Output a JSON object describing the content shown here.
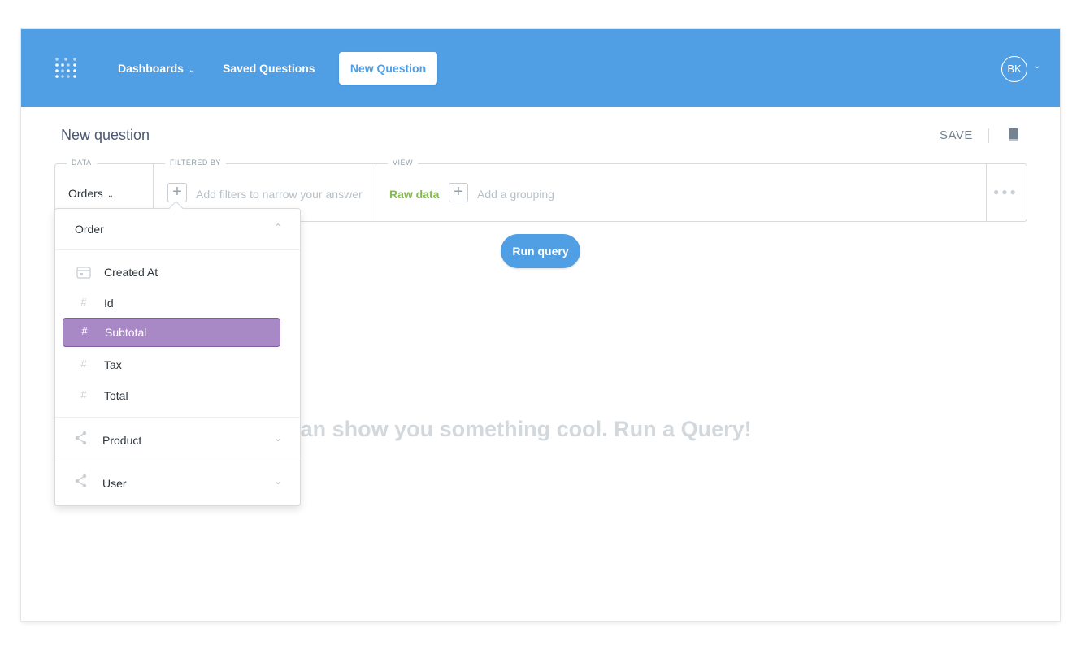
{
  "nav": {
    "logo_icon": "metabase-logo-icon",
    "dashboards": "Dashboards",
    "saved_questions": "Saved Questions",
    "new_question": "New Question",
    "avatar_initials": "BK"
  },
  "header": {
    "title": "New question",
    "save_label": "SAVE",
    "reference_icon": "book-icon"
  },
  "query": {
    "data_label": "DATA",
    "table": "Orders",
    "filter_label": "FILTERED BY",
    "filter_hint": "Add filters to narrow your answer",
    "view_label": "VIEW",
    "view_value": "Raw data",
    "grouping_hint": "Add a grouping",
    "more_icon": "ellipsis-icon"
  },
  "run_label": "Run query",
  "empty_message": "me some data I can show you something cool. Run a Query!",
  "field_picker": {
    "sections": [
      {
        "name": "Order",
        "expanded": true
      },
      {
        "name": "Product",
        "expanded": false
      },
      {
        "name": "User",
        "expanded": false
      }
    ],
    "fields": [
      {
        "label": "Created At",
        "icon": "calendar-icon"
      },
      {
        "label": "Id",
        "icon": "#"
      },
      {
        "label": "Subtotal",
        "icon": "#",
        "selected": true
      },
      {
        "label": "Tax",
        "icon": "#"
      },
      {
        "label": "Total",
        "icon": "#"
      }
    ]
  },
  "colors": {
    "brand": "#509ee3",
    "selected": "#a989c5",
    "raw_data": "#84bb4c"
  }
}
